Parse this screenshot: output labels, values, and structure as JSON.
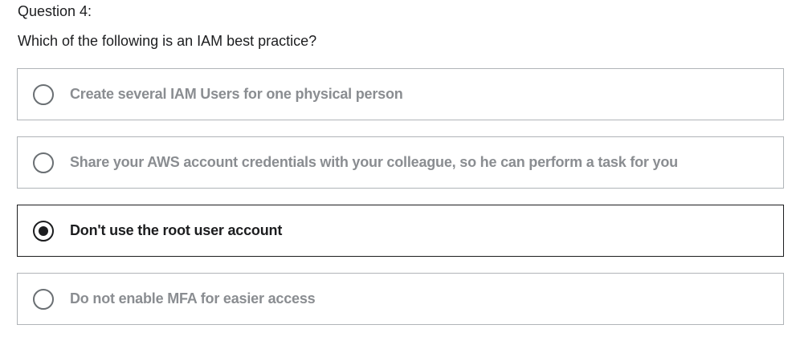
{
  "question": {
    "number_label": "Question 4:",
    "text": "Which of the following is an IAM best practice?"
  },
  "options": [
    {
      "label": "Create several IAM Users for one physical person",
      "selected": false
    },
    {
      "label": "Share your AWS account credentials with your colleague, so he can perform a task for you",
      "selected": false
    },
    {
      "label": "Don't use the root user account",
      "selected": true
    },
    {
      "label": "Do not enable MFA for easier access",
      "selected": false
    }
  ],
  "colors": {
    "text_primary": "#1c1d1f",
    "text_unselected": "#8a8d91",
    "border_unselected": "#b0b4b8",
    "border_selected": "#1c1d1f"
  }
}
